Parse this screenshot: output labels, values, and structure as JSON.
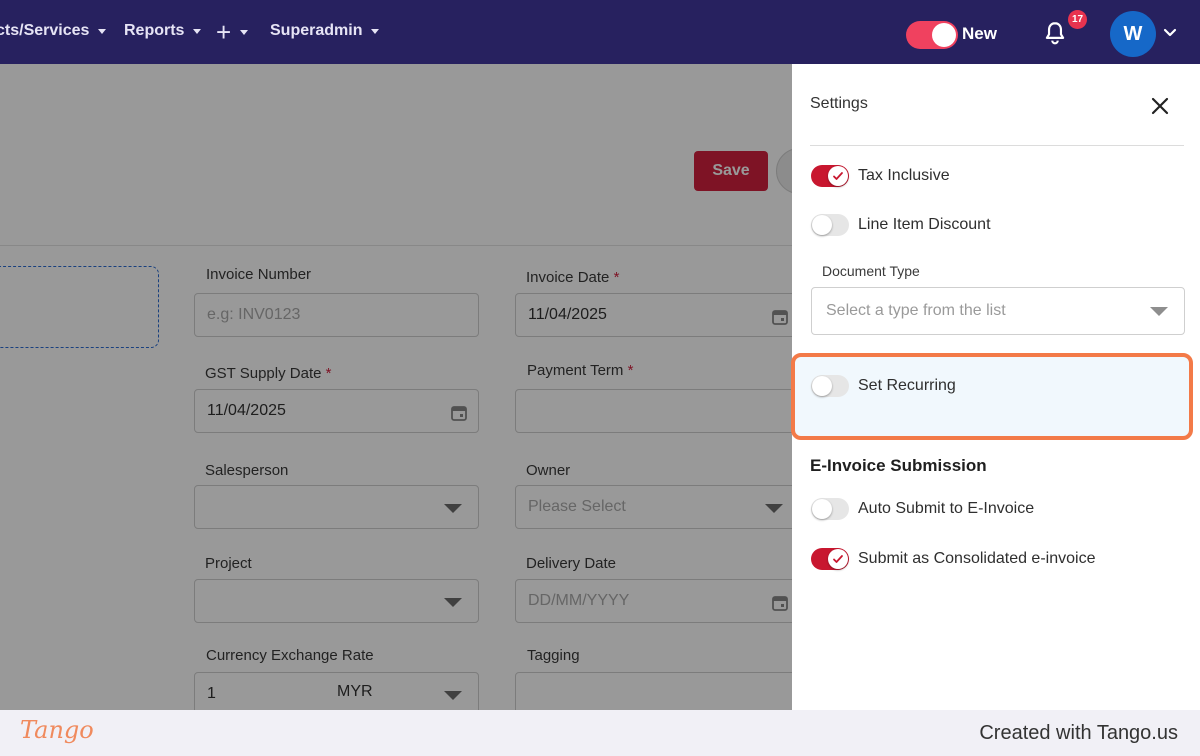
{
  "nav": {
    "items": [
      "cts/Services",
      "Reports",
      "+",
      "Superadmin"
    ],
    "new_label": "New",
    "notification_count": "17",
    "avatar_initial": "W"
  },
  "toolbar": {
    "save_label": "Save"
  },
  "form": {
    "invoice_number": {
      "label": "Invoice Number",
      "placeholder": "e.g: INV0123"
    },
    "invoice_date": {
      "label": "Invoice Date",
      "value": "11/04/2025"
    },
    "gst_supply_date": {
      "label": "GST Supply Date",
      "value": "11/04/2025"
    },
    "payment_term": {
      "label": "Payment Term",
      "value": ""
    },
    "salesperson": {
      "label": "Salesperson",
      "value": ""
    },
    "owner": {
      "label": "Owner",
      "placeholder": "Please Select"
    },
    "project": {
      "label": "Project",
      "value": ""
    },
    "delivery_date": {
      "label": "Delivery Date",
      "placeholder": "DD/MM/YYYY"
    },
    "currency_exchange_rate": {
      "label": "Currency Exchange Rate",
      "value": "1",
      "currency": "MYR"
    },
    "tagging": {
      "label": "Tagging",
      "value": ""
    },
    "required_mark": "*"
  },
  "settings": {
    "title": "Settings",
    "tax_inclusive": {
      "label": "Tax Inclusive",
      "on": true
    },
    "line_item_discount": {
      "label": "Line Item Discount",
      "on": false
    },
    "document_type": {
      "label": "Document Type",
      "placeholder": "Select a type from the list"
    },
    "set_recurring": {
      "label": "Set Recurring",
      "on": false
    },
    "einvoice_title": "E-Invoice Submission",
    "auto_submit": {
      "label": "Auto Submit to E-Invoice",
      "on": false
    },
    "consolidated": {
      "label": "Submit as Consolidated e-invoice",
      "on": true
    }
  },
  "footer": {
    "logo": "Tango",
    "created_with": "Created with Tango.us"
  },
  "colors": {
    "nav_bg": "#27215f",
    "accent_red": "#c8172f",
    "highlight_orange": "#f37a48",
    "avatar_blue": "#1668c8"
  }
}
